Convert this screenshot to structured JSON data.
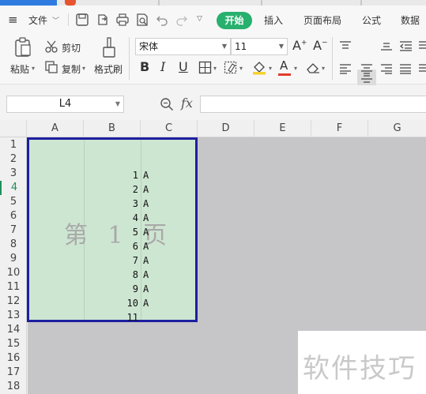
{
  "menu": {
    "file_label": "文件",
    "tabs": [
      {
        "label": "开始",
        "active": true
      },
      {
        "label": "插入"
      },
      {
        "label": "页面布局"
      },
      {
        "label": "公式"
      },
      {
        "label": "数据"
      }
    ]
  },
  "ribbon": {
    "paste_label": "粘贴",
    "cut_label": "剪切",
    "copy_label": "复制",
    "format_painter_label": "格式刷",
    "font_name": "宋体",
    "font_size": "11"
  },
  "formula_bar": {
    "name_box": "L4",
    "fx_label": "fx",
    "formula": ""
  },
  "columns": [
    "A",
    "B",
    "C",
    "D",
    "E",
    "F",
    "G"
  ],
  "rows": [
    "1",
    "2",
    "3",
    "4",
    "5",
    "6",
    "7",
    "8",
    "9",
    "10",
    "11",
    "12",
    "13",
    "14",
    "15",
    "16",
    "17",
    "18"
  ],
  "selected_row": "4",
  "page_label": "第 1 页",
  "cells": [
    {
      "num": "1",
      "suffix": "A"
    },
    {
      "num": "2",
      "suffix": "A"
    },
    {
      "num": "3",
      "suffix": "A"
    },
    {
      "num": "4",
      "suffix": "A"
    },
    {
      "num": "5",
      "suffix": "A"
    },
    {
      "num": "6",
      "suffix": "A"
    },
    {
      "num": "7",
      "suffix": "A"
    },
    {
      "num": "8",
      "suffix": "A"
    },
    {
      "num": "9",
      "suffix": "A"
    },
    {
      "num": "10",
      "suffix": "A"
    },
    {
      "num": "11",
      "suffix": ""
    }
  ],
  "watermark": "软件技巧",
  "colors": {
    "active_tab": "#27b06e",
    "page_fill": "#cde6d2",
    "page_border": "#1d1fa0",
    "outside_area": "#c6c5c7"
  }
}
